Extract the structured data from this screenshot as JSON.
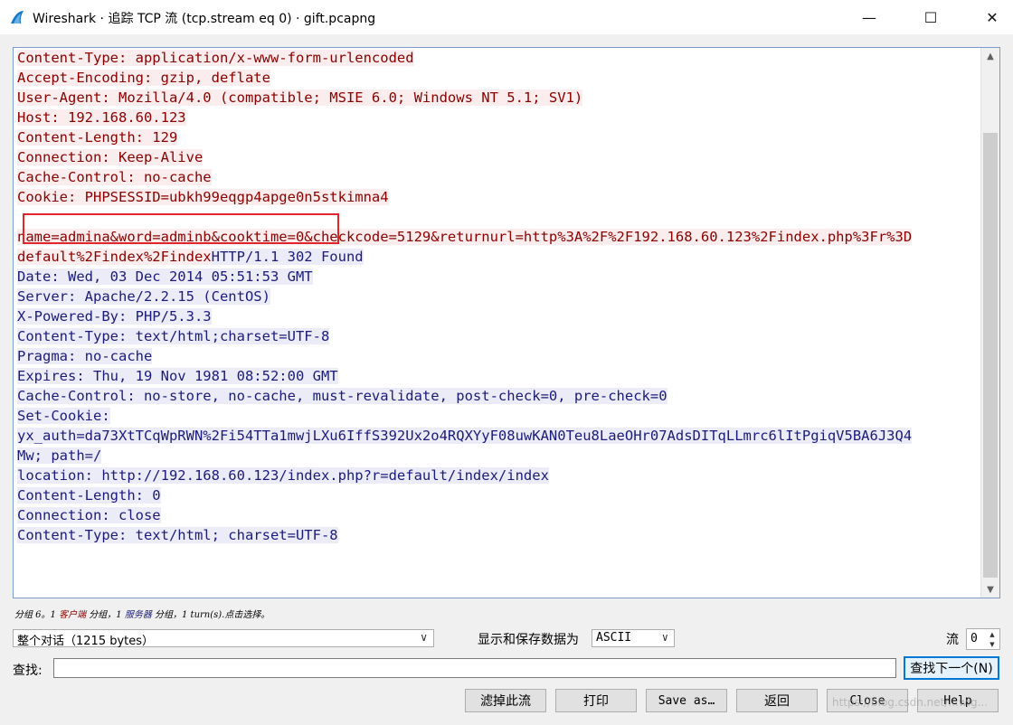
{
  "window": {
    "title": "Wireshark · 追踪 TCP 流 (tcp.stream eq 0) · gift.pcapng",
    "app_icon": "wireshark-fin-icon",
    "controls": [
      "minimize-icon",
      "maximize-icon",
      "close-icon"
    ]
  },
  "colors": {
    "client_text": "#8b0000",
    "client_bg": "#fbeded",
    "server_text": "#1b1b7a",
    "server_bg": "#ececf9",
    "highlight_box": "#e0262b"
  },
  "stream": {
    "lines": [
      {
        "text": "Content-Type: application/x-www-form-urlencoded",
        "side": "client"
      },
      {
        "text": "Accept-Encoding: gzip, deflate",
        "side": "client"
      },
      {
        "text": "User-Agent: Mozilla/4.0 (compatible; MSIE 6.0; Windows NT 5.1; SV1)",
        "side": "client"
      },
      {
        "text": "Host: 192.168.60.123",
        "side": "client"
      },
      {
        "text": "Content-Length: 129",
        "side": "client"
      },
      {
        "text": "Connection: Keep-Alive",
        "side": "client"
      },
      {
        "text": "Cache-Control: no-cache",
        "side": "client"
      },
      {
        "text": "Cookie: PHPSESSID=ubkh99eqgp4apge0n5stkimna4",
        "side": "client"
      },
      {
        "text": "",
        "side": "client"
      },
      {
        "text": "name=admina&word=adminb&cooktime=0&checkcode=5129&returnurl=http%3A%2F%2F192.168.60.123%2Findex.php%3Fr%3D",
        "side": "client"
      },
      {
        "parts": [
          {
            "text": "default%2Findex%2Findex",
            "side": "client"
          },
          {
            "text": "HTTP/1.1 302 Found",
            "side": "server"
          }
        ]
      },
      {
        "text": "Date: Wed, 03 Dec 2014 05:51:53 GMT",
        "side": "server"
      },
      {
        "text": "Server: Apache/2.2.15 (CentOS)",
        "side": "server"
      },
      {
        "text": "X-Powered-By: PHP/5.3.3",
        "side": "server"
      },
      {
        "text": "Content-Type: text/html;charset=UTF-8",
        "side": "server"
      },
      {
        "text": "Pragma: no-cache",
        "side": "server"
      },
      {
        "text": "Expires: Thu, 19 Nov 1981 08:52:00 GMT",
        "side": "server"
      },
      {
        "text": "Cache-Control: no-store, no-cache, must-revalidate, post-check=0, pre-check=0",
        "side": "server"
      },
      {
        "text": "Set-Cookie:",
        "side": "server"
      },
      {
        "text": "yx_auth=da73XtTCqWpRWN%2Fi54TTa1mwjLXu6IffS392Ux2o4RQXYyF08uwKAN0Teu8LaeOHr07AdsDITqLLmrc6lItPgiqV5BA6J3Q4",
        "side": "server"
      },
      {
        "text": "Mw; path=/",
        "side": "server"
      },
      {
        "text": "location: http://192.168.60.123/index.php?r=default/index/index",
        "side": "server"
      },
      {
        "text": "Content-Length: 0",
        "side": "server"
      },
      {
        "text": "Connection: close",
        "side": "server"
      },
      {
        "text": "Content-Type: text/html; charset=UTF-8",
        "side": "server"
      }
    ]
  },
  "status": {
    "prefix": "分组 6。1 ",
    "client": "客户端",
    "mid": " 分组，1 ",
    "server": "服务器",
    "suffix": " 分组，1 turn(s).点击选择。"
  },
  "controls": {
    "conversation_select": "整个对话（1215 bytes）",
    "show_save_label": "显示和保存数据为",
    "format_select": "ASCII",
    "stream_label": "流",
    "stream_value": "0",
    "find_label": "查找:",
    "find_value": "",
    "find_next_button": "查找下一个(N)"
  },
  "buttons": {
    "filter": "滤掉此流",
    "print": "打印",
    "save_as": "Save as…",
    "back": "返回",
    "close": "Close",
    "help": "Help"
  },
  "watermark": "https://blog.csdn.net/...wig..."
}
